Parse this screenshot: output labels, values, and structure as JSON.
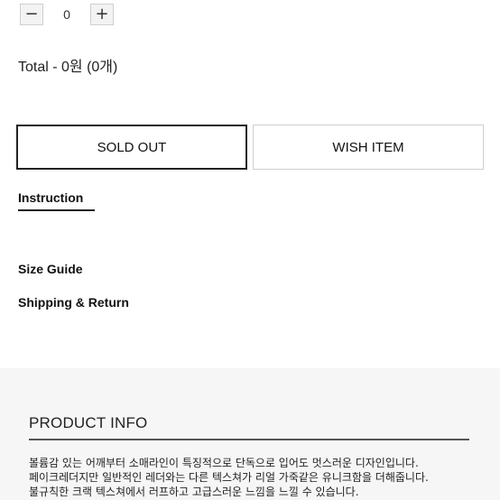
{
  "quantity": {
    "minus_symbol": "−",
    "plus_symbol": "+",
    "value": "0"
  },
  "total": "Total - 0원 (0개)",
  "buttons": {
    "sold_out": "SOLD OUT",
    "wish_item": "WISH ITEM"
  },
  "tabs": {
    "instruction": "Instruction"
  },
  "links": {
    "size_guide": "Size Guide",
    "shipping_return": "Shipping & Return"
  },
  "product_info": {
    "title": "PRODUCT INFO",
    "lines": [
      "볼륨감 있는 어깨부터 소매라인이 특징적으로 단독으로 입어도 멋스러운 디자인입니다.",
      "페이크레더지만 일반적인 레더와는 다른 텍스쳐가 리얼 가죽같은 유니크함을 더해줍니다.",
      "불규칙한 크랙 텍스쳐에서 러프하고 고급스러운 느낌을 느낄 수 있습니다."
    ]
  },
  "colors": {
    "accent_border": "#222222",
    "light_border": "#cfcfcf",
    "panel_bg": "#f6f6f6"
  }
}
